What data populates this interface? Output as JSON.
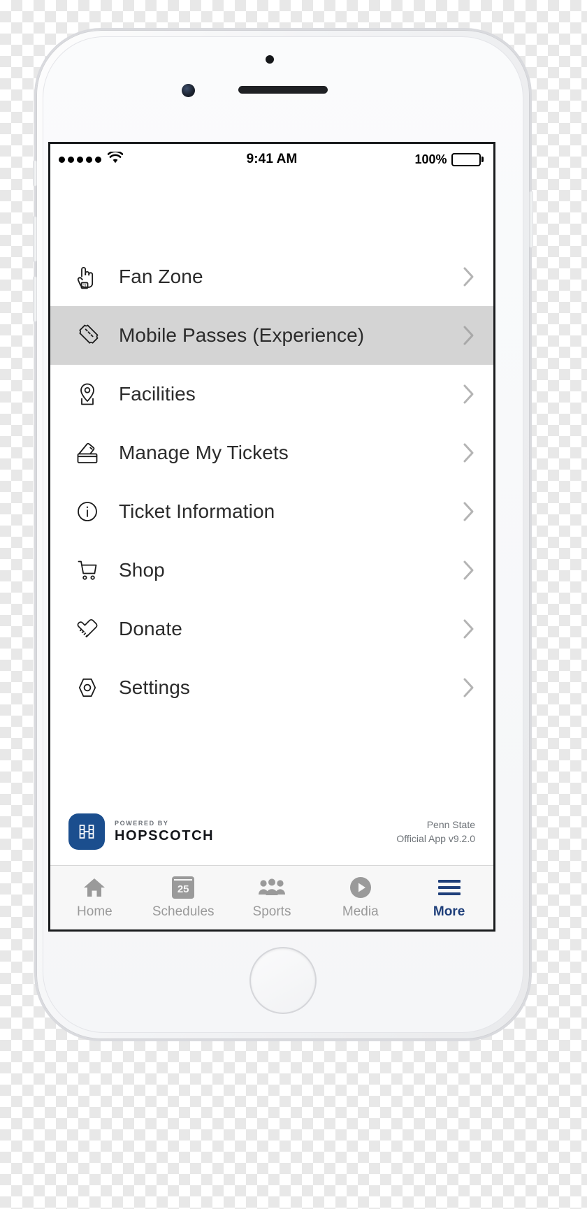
{
  "status_bar": {
    "signal_dots": 5,
    "wifi_icon": "wifi-icon",
    "time": "9:41 AM",
    "battery_percent": "100%"
  },
  "menu": {
    "items": [
      {
        "label": "Fan Zone",
        "icon": "foam-finger-icon",
        "selected": false
      },
      {
        "label": "Mobile Passes (Experience)",
        "icon": "ticket-icon",
        "selected": true
      },
      {
        "label": "Facilities",
        "icon": "map-pin-icon",
        "selected": false
      },
      {
        "label": "Manage My Tickets",
        "icon": "ticket-wallet-icon",
        "selected": false
      },
      {
        "label": "Ticket Information",
        "icon": "info-circle-icon",
        "selected": false
      },
      {
        "label": "Shop",
        "icon": "shopping-cart-icon",
        "selected": false
      },
      {
        "label": "Donate",
        "icon": "handshake-icon",
        "selected": false
      },
      {
        "label": "Settings",
        "icon": "hex-nut-icon",
        "selected": false
      }
    ],
    "chevron_icon": "chevron-right-icon",
    "selected_row_color": "#d4d4d4"
  },
  "footer": {
    "powered_by": "POWERED BY",
    "brand": "HOPSCOTCH",
    "brand_mark_icon": "hopscotch-logo-icon",
    "brand_color": "#1b4e8e",
    "org_line1": "Penn State",
    "org_line2": "Official App v9.2.0"
  },
  "tab_bar": {
    "active_color": "#1f3f7a",
    "inactive_color": "#9a9a9a",
    "tabs": [
      {
        "label": "Home",
        "icon": "home-icon",
        "active": false
      },
      {
        "label": "Schedules",
        "icon": "calendar-icon",
        "active": false,
        "badge": "25"
      },
      {
        "label": "Sports",
        "icon": "people-group-icon",
        "active": false
      },
      {
        "label": "Media",
        "icon": "play-circle-icon",
        "active": false
      },
      {
        "label": "More",
        "icon": "hamburger-icon",
        "active": true
      }
    ]
  }
}
